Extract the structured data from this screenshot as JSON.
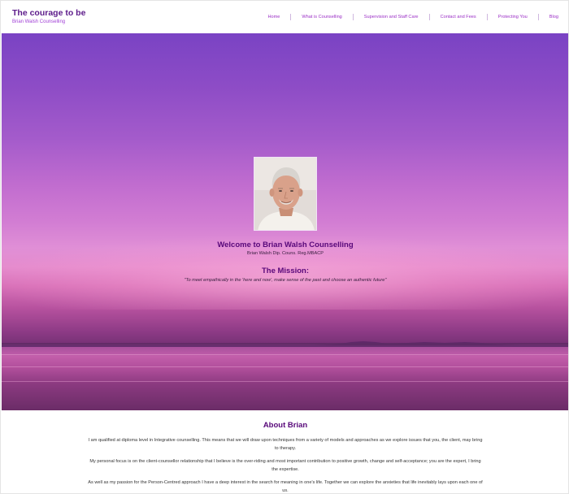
{
  "header": {
    "title": "The courage to be",
    "subtitle": "Brian Walsh Counselling"
  },
  "nav": {
    "items": [
      {
        "label": "Home"
      },
      {
        "label": "What is Counselling"
      },
      {
        "label": "Supervision and Staff Care"
      },
      {
        "label": "Contact and Fees"
      },
      {
        "label": "Protecting You"
      },
      {
        "label": "Blog"
      }
    ]
  },
  "hero": {
    "portrait_alt": "Portrait of Brian Walsh",
    "welcome": "Welcome to Brian Walsh Counselling",
    "qualifications": "Brian Walsh Dip. Couns. Reg.MBACP",
    "mission_heading": "The Mission:",
    "mission_quote": "\"To meet empathically in the 'here and now', make sense of the past and choose an authentic future\""
  },
  "about": {
    "heading": "About Brian",
    "paragraphs": [
      "I am qualified at diploma level in Integrative counselling. This means that we will draw upon techniques from a variety of models and approaches as we explore issues that you, the client, may bring to therapy.",
      "My personal focus is on the client-counsellor relationship that I believe is the over-riding and most important contribution to positive growth, change and self-acceptance; you are the expert, I bring the expertise.",
      "As well as my passion for the Person-Centred approach I have a deep interest in the search for meaning in one's life. Together we can explore the anxieties that life inevitably lays upon each one of us."
    ]
  },
  "colors": {
    "brand_purple": "#58087a",
    "nav_purple": "#9b2fc6"
  }
}
